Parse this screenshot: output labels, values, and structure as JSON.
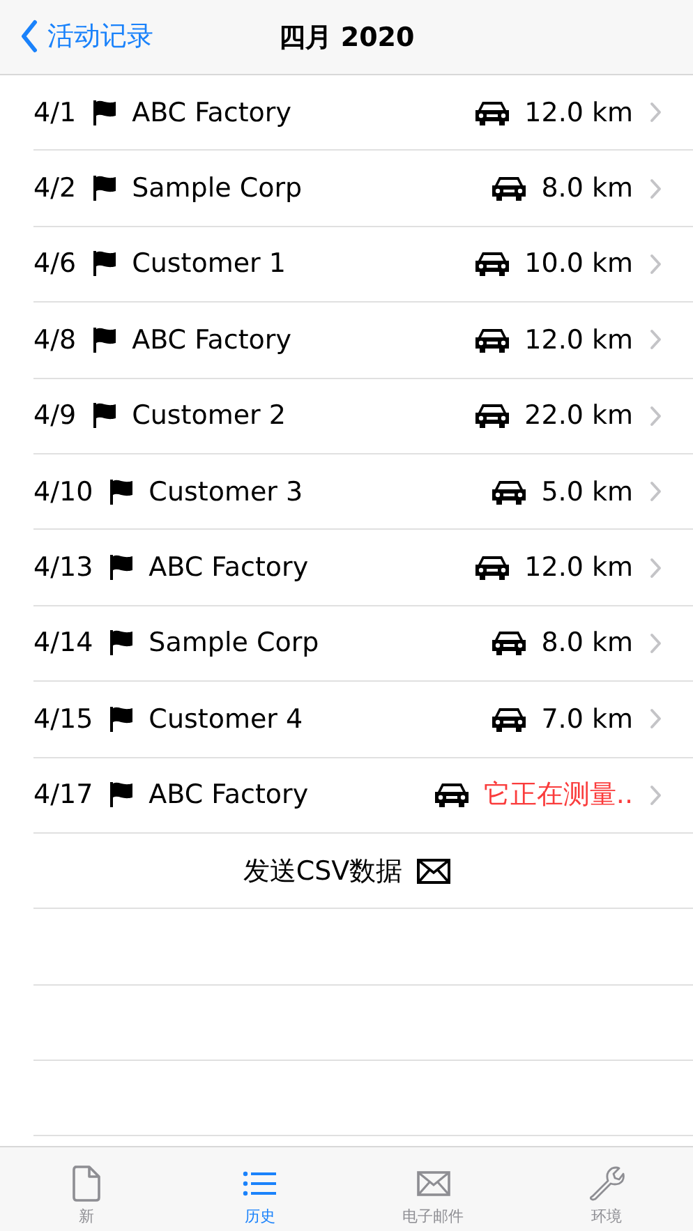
{
  "nav": {
    "back": "活动记录",
    "title": "四月 2020"
  },
  "trips": [
    {
      "date": "4/1",
      "place": "ABC Factory",
      "distance": "12.0 km",
      "measuring": false
    },
    {
      "date": "4/2",
      "place": "Sample Corp",
      "distance": "8.0 km",
      "measuring": false
    },
    {
      "date": "4/6",
      "place": "Customer 1",
      "distance": "10.0 km",
      "measuring": false
    },
    {
      "date": "4/8",
      "place": "ABC Factory",
      "distance": "12.0 km",
      "measuring": false
    },
    {
      "date": "4/9",
      "place": "Customer 2",
      "distance": "22.0 km",
      "measuring": false
    },
    {
      "date": "4/10",
      "place": "Customer 3",
      "distance": "5.0 km",
      "measuring": false
    },
    {
      "date": "4/13",
      "place": "ABC Factory",
      "distance": "12.0 km",
      "measuring": false
    },
    {
      "date": "4/14",
      "place": "Sample Corp",
      "distance": "8.0 km",
      "measuring": false
    },
    {
      "date": "4/15",
      "place": "Customer 4",
      "distance": "7.0 km",
      "measuring": false
    },
    {
      "date": "4/17",
      "place": "ABC Factory",
      "distance": "它正在测量..",
      "measuring": true
    }
  ],
  "send_button": "发送CSV数据",
  "tabs": [
    {
      "kind": "document",
      "label": "新",
      "selected": false
    },
    {
      "kind": "list",
      "label": "历史",
      "selected": true
    },
    {
      "kind": "mail",
      "label": "电子邮件",
      "selected": false
    },
    {
      "kind": "wrench",
      "label": "环境",
      "selected": false
    }
  ]
}
